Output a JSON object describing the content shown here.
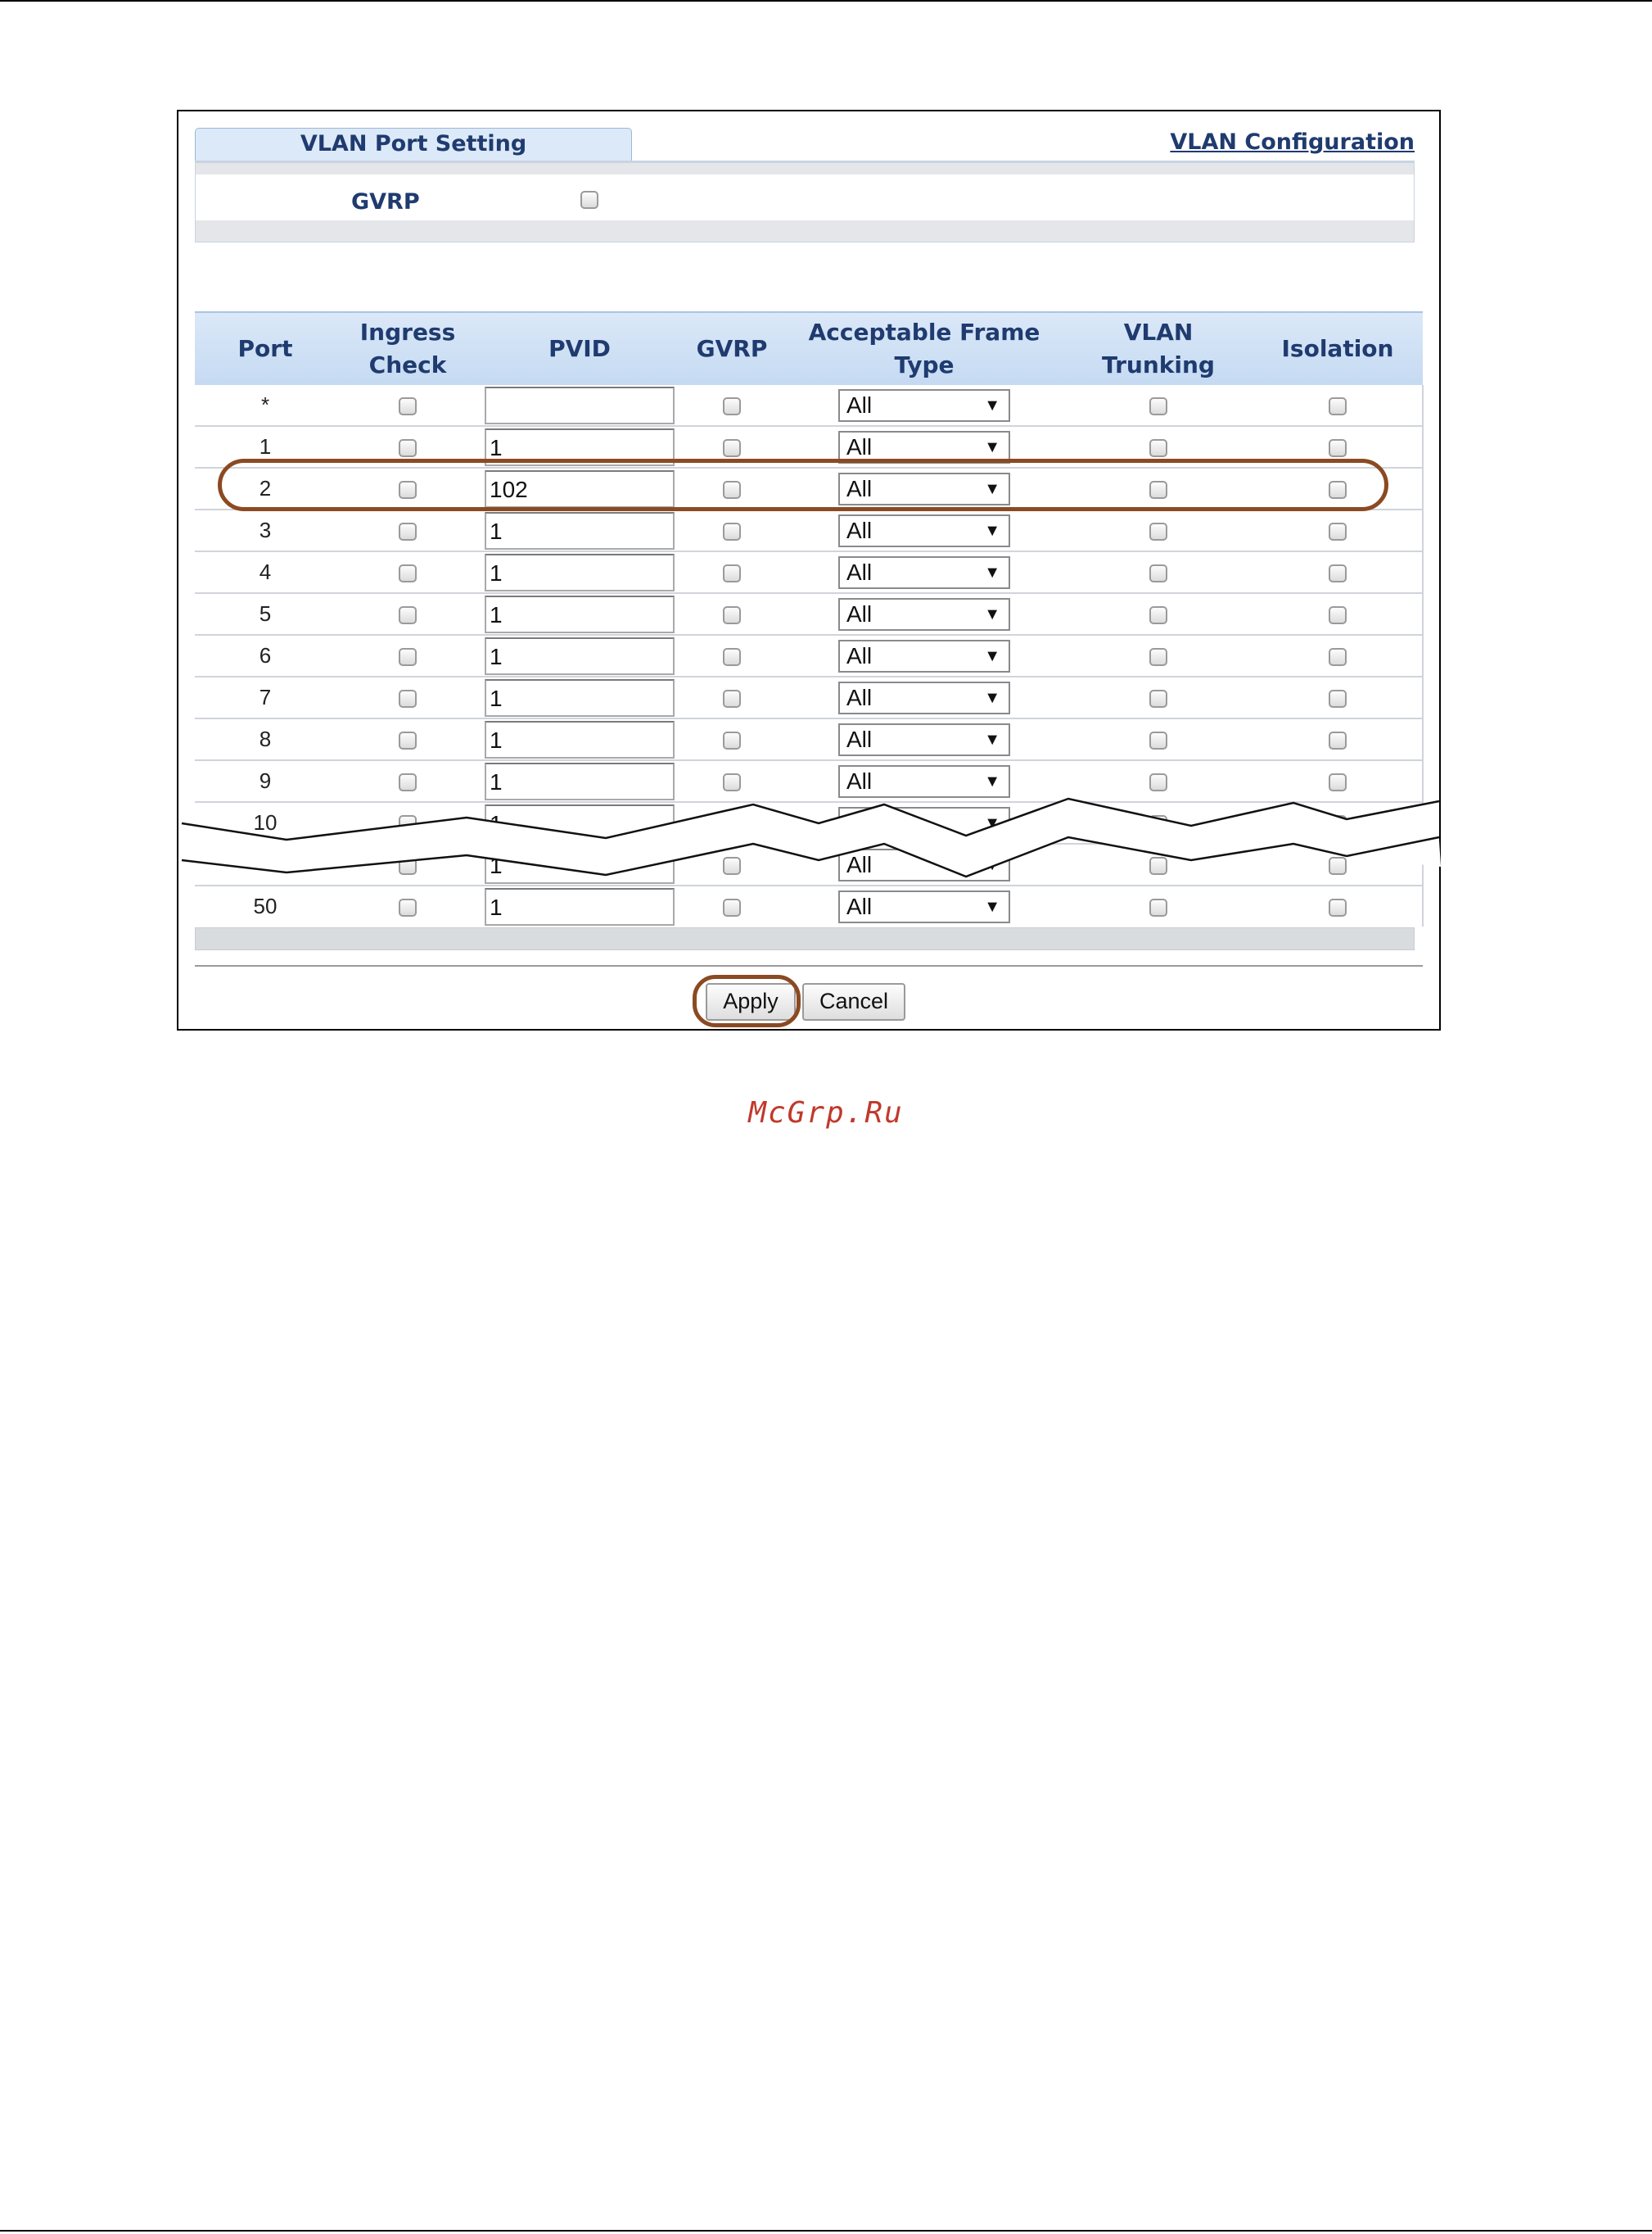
{
  "tab": {
    "label": "VLAN Port Setting"
  },
  "config_link": {
    "label": "VLAN Configuration"
  },
  "global": {
    "gvrp_label": "GVRP",
    "gvrp_checked": false
  },
  "table": {
    "headers": {
      "port": "Port",
      "ingress": "Ingress\nCheck",
      "pvid": "PVID",
      "gvrp": "GVRP",
      "frame_type": "Acceptable Frame Type",
      "trunking": "VLAN Trunking",
      "isolation": "Isolation"
    },
    "rows": [
      {
        "port": "*",
        "pvid": "",
        "frame_type": "All"
      },
      {
        "port": "1",
        "pvid": "1",
        "frame_type": "All"
      },
      {
        "port": "2",
        "pvid": "102",
        "frame_type": "All",
        "highlighted": true
      },
      {
        "port": "3",
        "pvid": "1",
        "frame_type": "All"
      },
      {
        "port": "4",
        "pvid": "1",
        "frame_type": "All"
      },
      {
        "port": "5",
        "pvid": "1",
        "frame_type": "All"
      },
      {
        "port": "6",
        "pvid": "1",
        "frame_type": "All"
      },
      {
        "port": "7",
        "pvid": "1",
        "frame_type": "All"
      },
      {
        "port": "8",
        "pvid": "1",
        "frame_type": "All"
      },
      {
        "port": "9",
        "pvid": "1",
        "frame_type": "All"
      },
      {
        "port": "10",
        "pvid": "1",
        "frame_type": "All"
      },
      {
        "port": "",
        "pvid": "1",
        "frame_type": "All"
      },
      {
        "port": "50",
        "pvid": "1",
        "frame_type": "All"
      }
    ]
  },
  "buttons": {
    "apply": "Apply",
    "cancel": "Cancel"
  },
  "watermark": "McGrp.Ru",
  "colors": {
    "header_text": "#1f3b6f",
    "highlight": "#8b4a22",
    "watermark": "#c0392b"
  }
}
